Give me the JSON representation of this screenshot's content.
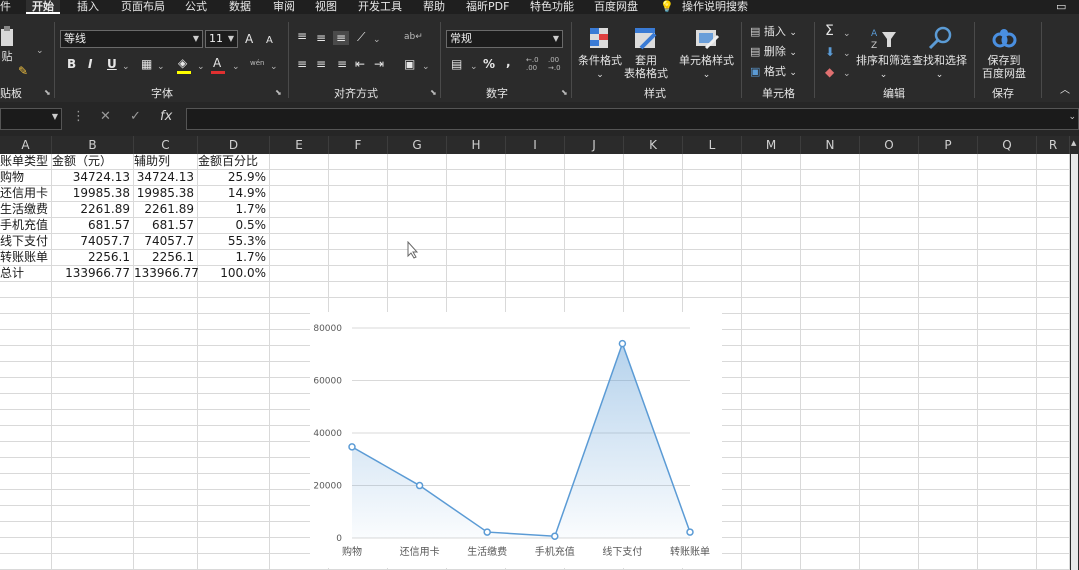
{
  "menu": {
    "items": [
      "件",
      "开始",
      "插入",
      "页面布局",
      "公式",
      "数据",
      "审阅",
      "视图",
      "开发工具",
      "帮助",
      "福昕PDF",
      "特色功能",
      "百度网盘",
      "操作说明搜索"
    ],
    "active": "开始"
  },
  "ribbon": {
    "clipboard": {
      "label": "贴板",
      "paste_label": "贴"
    },
    "font": {
      "label": "字体",
      "name": "等线",
      "size": "11",
      "grow": "A",
      "shrink": "A",
      "bold": "B",
      "italic": "I",
      "underline": "U",
      "phonetic": "wén"
    },
    "align": {
      "label": "对齐方式"
    },
    "number": {
      "label": "数字",
      "format": "常规",
      "percent": "%",
      "comma": ",",
      "inc_decimal": "←.0\n.00",
      "dec_decimal": ".00\n→.0"
    },
    "styles": {
      "label": "样式",
      "cond_format": "条件格式",
      "table_format_1": "套用",
      "table_format_2": "表格格式",
      "cell_style": "单元格样式"
    },
    "cells": {
      "label": "单元格",
      "insert": "插入",
      "delete": "删除",
      "format": "格式"
    },
    "editing": {
      "label": "编辑",
      "sum": "Σ",
      "sort_filter": "排序和筛选",
      "find_select": "查找和选择"
    },
    "save": {
      "label": "保存",
      "save_to_1": "保存到",
      "save_to_2": "百度网盘"
    }
  },
  "formula": {
    "fx": "fx",
    "cancel": "✕",
    "confirm": "✓",
    "name_value": "",
    "content": ""
  },
  "columns": [
    "A",
    "B",
    "C",
    "D",
    "E",
    "F",
    "G",
    "H",
    "I",
    "J",
    "K",
    "L",
    "M",
    "N",
    "O",
    "P",
    "Q",
    "R"
  ],
  "table": {
    "headers": [
      "账单类型",
      "金额（元）",
      "辅助列",
      "金额百分比"
    ],
    "rows": [
      [
        "购物",
        "34724.13",
        "34724.13",
        "25.9%"
      ],
      [
        "还信用卡",
        "19985.38",
        "19985.38",
        "14.9%"
      ],
      [
        "生活缴费",
        "2261.89",
        "2261.89",
        "1.7%"
      ],
      [
        "手机充值",
        "681.57",
        "681.57",
        "0.5%"
      ],
      [
        "线下支付",
        "74057.7",
        "74057.7",
        "55.3%"
      ],
      [
        "转账账单",
        "2256.1",
        "2256.1",
        "1.7%"
      ],
      [
        "总计",
        "133966.77",
        "133966.77",
        "100.0%"
      ]
    ]
  },
  "colors": {
    "accent": "#5b9bd5",
    "ribbon_bg": "#2b2b2b",
    "grid": "#d9d9d9"
  },
  "chart_data": {
    "type": "area",
    "categories": [
      "购物",
      "还信用卡",
      "生活缴费",
      "手机充值",
      "线下支付",
      "转账账单"
    ],
    "values": [
      34724.13,
      19985.38,
      2261.89,
      681.57,
      74057.7,
      2256.1
    ],
    "yticks": [
      "0",
      "20000",
      "40000",
      "60000",
      "80000"
    ],
    "ylim": [
      0,
      80000
    ],
    "grid": true,
    "title": "",
    "xlabel": "",
    "ylabel": ""
  }
}
